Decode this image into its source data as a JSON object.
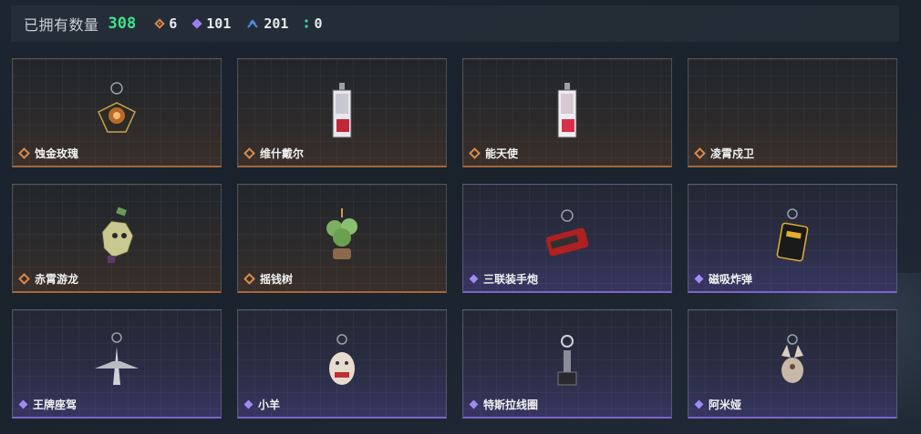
{
  "header": {
    "owned_label": "已拥有数量",
    "owned_count": "308",
    "stats": [
      {
        "icon": "orange-diamond-icon",
        "value": "6"
      },
      {
        "icon": "purple-diamond-icon",
        "value": "101"
      },
      {
        "icon": "blue-chevrons-icon",
        "value": "201"
      },
      {
        "icon": "teal-dots-icon",
        "value": "0"
      }
    ]
  },
  "items": [
    {
      "name": "蚀金玫瑰",
      "rarity": "orange"
    },
    {
      "name": "维什戴尔",
      "rarity": "orange"
    },
    {
      "name": "能天使",
      "rarity": "orange"
    },
    {
      "name": "凌霄戍卫",
      "rarity": "orange"
    },
    {
      "name": "赤霄游龙",
      "rarity": "orange"
    },
    {
      "name": "摇钱树",
      "rarity": "orange"
    },
    {
      "name": "三联装手炮",
      "rarity": "purple"
    },
    {
      "name": "磁吸炸弹",
      "rarity": "purple"
    },
    {
      "name": "王牌座驾",
      "rarity": "purple"
    },
    {
      "name": "小羊",
      "rarity": "purple"
    },
    {
      "name": "特斯拉线圈",
      "rarity": "purple"
    },
    {
      "name": "阿米娅",
      "rarity": "purple"
    }
  ],
  "colors": {
    "owned_count": "#3de38a",
    "orange_rarity": "#d98a4a",
    "purple_rarity": "#9a7ef0",
    "blue_stat": "#4a8fe0",
    "teal_stat": "#3fd0b0"
  }
}
